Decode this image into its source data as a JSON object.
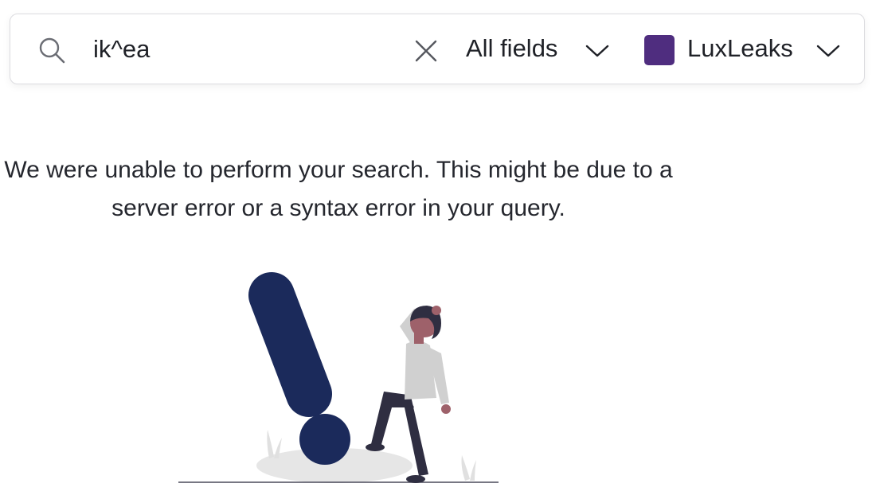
{
  "search": {
    "query": "ik^ea",
    "field_filter": "All fields",
    "dataset": {
      "name": "LuxLeaks",
      "color": "#4f2d7f"
    }
  },
  "error": {
    "message": "We were unable to perform your search. This might be due to a server error or a syntax error in your query."
  },
  "icons": {
    "search": "search-icon",
    "clear": "close-icon",
    "dropdown": "chevron-down-icon",
    "illustration": "error-exclamation-person-illustration"
  },
  "colors": {
    "exclamation": "#1b2a5b",
    "text": "#1f2127",
    "border": "#dcdce0"
  }
}
